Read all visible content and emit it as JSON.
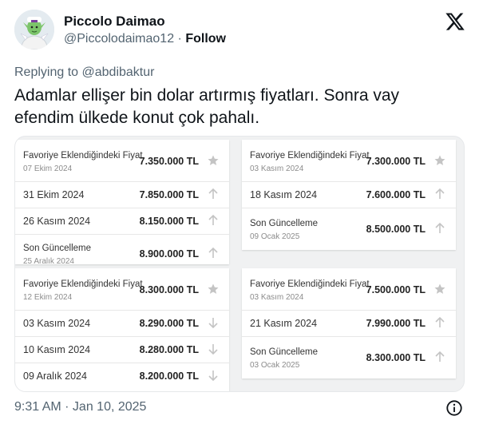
{
  "author": {
    "name": "Piccolo Daimao",
    "handle": "@Piccolodaimao12",
    "separator": "·",
    "follow_label": "Follow",
    "avatar_icon": "piccolo-avatar"
  },
  "reply": {
    "prefix": "Replying to",
    "mention": "@abdibaktur"
  },
  "tweet": {
    "text": "Adamlar ellişer bin dolar artırmış fiyatları. Sonra vay efendim ülkede konut çok pahalı."
  },
  "media": {
    "cards": [
      {
        "rows": [
          {
            "label": "Favoriye Eklendiğindeki Fiyat",
            "sub": "07 Ekim 2024",
            "price": "7.350.000 TL",
            "icon": "star-icon"
          },
          {
            "label": "31 Ekim 2024",
            "sub": "",
            "price": "7.850.000 TL",
            "icon": "arrow-up-icon"
          },
          {
            "label": "26 Kasım 2024",
            "sub": "",
            "price": "8.150.000 TL",
            "icon": "arrow-up-icon"
          },
          {
            "label": "Son Güncelleme",
            "sub": "25 Aralık 2024",
            "price": "8.900.000 TL",
            "icon": "arrow-up-icon"
          }
        ]
      },
      {
        "rows": [
          {
            "label": "Favoriye Eklendiğindeki Fiyat",
            "sub": "03 Kasım 2024",
            "price": "7.300.000 TL",
            "icon": "star-icon"
          },
          {
            "label": "18 Kasım 2024",
            "sub": "",
            "price": "7.600.000 TL",
            "icon": "arrow-up-icon"
          },
          {
            "label": "Son Güncelleme",
            "sub": "09 Ocak 2025",
            "price": "8.500.000 TL",
            "icon": "arrow-up-icon"
          }
        ]
      },
      {
        "rows": [
          {
            "label": "Favoriye Eklendiğindeki Fiyat",
            "sub": "12 Ekim 2024",
            "price": "8.300.000 TL",
            "icon": "star-icon"
          },
          {
            "label": "03 Kasım 2024",
            "sub": "",
            "price": "8.290.000 TL",
            "icon": "arrow-down-icon"
          },
          {
            "label": "10 Kasım 2024",
            "sub": "",
            "price": "8.280.000 TL",
            "icon": "arrow-down-icon"
          },
          {
            "label": "09 Aralık 2024",
            "sub": "",
            "price": "8.200.000 TL",
            "icon": "arrow-down-icon"
          }
        ]
      },
      {
        "rows": [
          {
            "label": "Favoriye Eklendiğindeki Fiyat",
            "sub": "03 Kasım 2024",
            "price": "7.500.000 TL",
            "icon": "star-icon"
          },
          {
            "label": "21 Kasım 2024",
            "sub": "",
            "price": "7.990.000 TL",
            "icon": "arrow-up-icon"
          },
          {
            "label": "Son Güncelleme",
            "sub": "03 Ocak 2025",
            "price": "8.300.000 TL",
            "icon": "arrow-up-icon"
          }
        ]
      }
    ]
  },
  "footer": {
    "timestamp": "9:31 AM · Jan 10, 2025",
    "info_icon": "info-icon"
  },
  "colors": {
    "text": "#0f1419",
    "secondary": "#536471",
    "icon_grey": "#c4c4c4"
  }
}
